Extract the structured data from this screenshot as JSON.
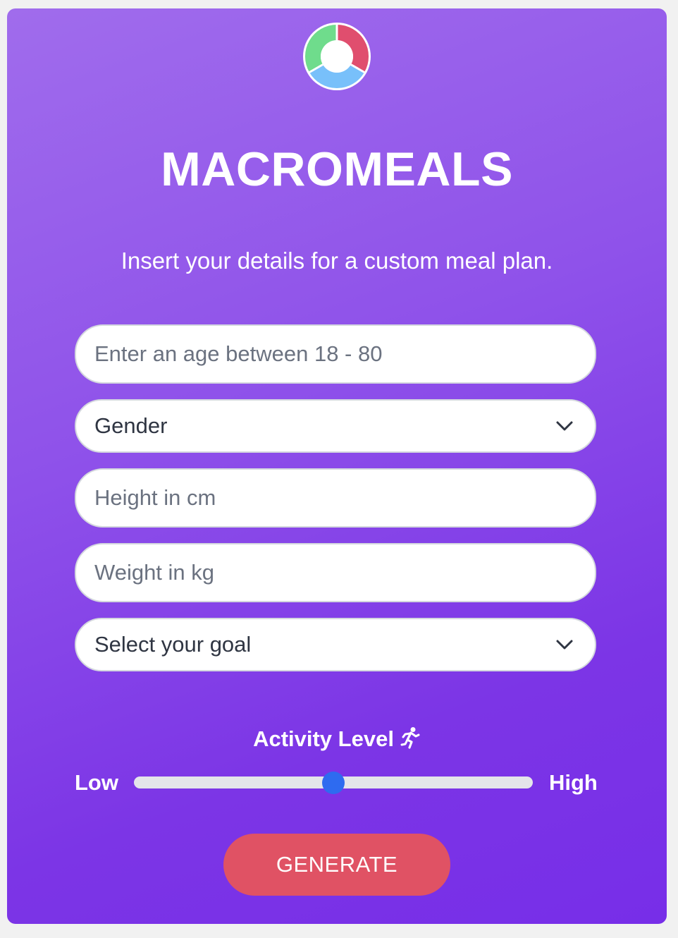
{
  "app": {
    "title": "MACROMEALS",
    "subtitle": "Insert your details for a custom meal plan.",
    "logo": "macro-donut-logo"
  },
  "form": {
    "age_placeholder": "Enter an age between 18 - 80",
    "gender_value": "Gender",
    "height_placeholder": "Height in cm",
    "weight_placeholder": "Weight in kg",
    "goal_value": "Select your goal"
  },
  "activity": {
    "label": "Activity Level",
    "icon": "running-person-icon",
    "low_label": "Low",
    "high_label": "High",
    "value_fraction": 0.5
  },
  "actions": {
    "generate_label": "GENERATE"
  },
  "colors": {
    "gradient_start": "#a06cec",
    "gradient_end": "#772ee8",
    "generate_button": "#e05264",
    "slider_thumb": "#2e6bf0",
    "logo_green": "#6fdc8c",
    "logo_red": "#e04e6e",
    "logo_blue": "#78c0fa"
  }
}
